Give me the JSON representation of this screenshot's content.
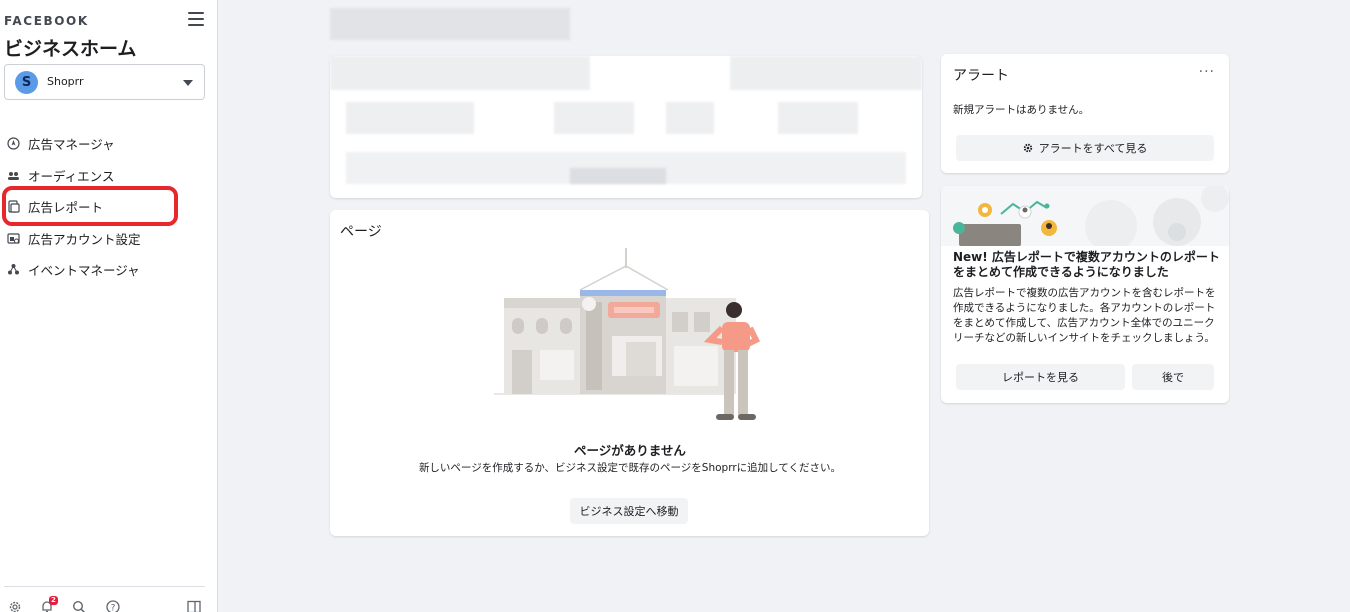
{
  "sidebar": {
    "brand": "FACEBOOK",
    "title": "ビジネスホーム",
    "account": {
      "initial": "S",
      "name": "Shoprr"
    },
    "items": [
      {
        "label": "広告マネージャ",
        "icon": "ads-manager-icon"
      },
      {
        "label": "オーディエンス",
        "icon": "audience-icon"
      },
      {
        "label": "広告レポート",
        "icon": "ad-reports-icon"
      },
      {
        "label": "広告アカウント設定",
        "icon": "ad-account-settings-icon"
      },
      {
        "label": "イベントマネージャ",
        "icon": "events-manager-icon"
      }
    ],
    "notification_count": "2"
  },
  "pages_card": {
    "title": "ページ",
    "empty_title": "ページがありません",
    "empty_desc": "新しいページを作成するか、ビジネス設定で既存のページをShoprrに追加してください。",
    "button": "ビジネス設定へ移動"
  },
  "alerts_card": {
    "title": "アラート",
    "menu": "···",
    "empty": "新規アラートはありません。",
    "button": "アラートをすべて見る"
  },
  "promo_card": {
    "headline": "New! 広告レポートで複数アカウントのレポートをまとめて作成できるようになりました",
    "body": "広告レポートで複数の広告アカウントを含むレポートを作成できるようになりました。各アカウントのレポートをまとめて作成して、広告アカウント全体でのユニークリーチなどの新しいインサイトをチェックしましょう。",
    "primary_button": "レポートを見る",
    "secondary_button": "後で"
  },
  "colors": {
    "highlight": "#e8272b",
    "avatar": "#5b9ae6",
    "background": "#f0f2f5"
  }
}
